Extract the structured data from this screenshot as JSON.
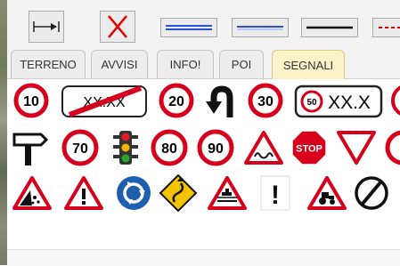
{
  "tabs": [
    {
      "label": "TERRENO"
    },
    {
      "label": "AVVISI"
    },
    {
      "label": "INFO!"
    },
    {
      "label": "POI"
    },
    {
      "label": "SEGNALI"
    }
  ],
  "active_tab": "SEGNALI",
  "colors": {
    "sign_red": "#d6001c",
    "sign_blue": "#1e5fb0",
    "sign_yellow": "#f5c400",
    "active_tab_bg": "#fdf3c9",
    "delete_x": "#e00000",
    "line_blue": "#2d4fd6"
  },
  "toolbar": {
    "buttons": [
      {
        "icon": "arrow-to-bar-icon"
      },
      {
        "icon": "delete-x-icon"
      },
      {
        "icon": "double-blue-line-icon"
      },
      {
        "icon": "blue-line-icon"
      },
      {
        "icon": "black-line-icon"
      },
      {
        "icon": "red-dashed-line-icon"
      }
    ]
  },
  "signs": {
    "speed_10": "10",
    "end_limit_xx": "XX.XX",
    "speed_20": "20",
    "speed_30": "30",
    "limit_50_inner": "50",
    "limit_50_text": "XX.X",
    "speed_70": "70",
    "speed_80": "80",
    "speed_90": "90",
    "stop": "STOP",
    "excl": "!"
  }
}
